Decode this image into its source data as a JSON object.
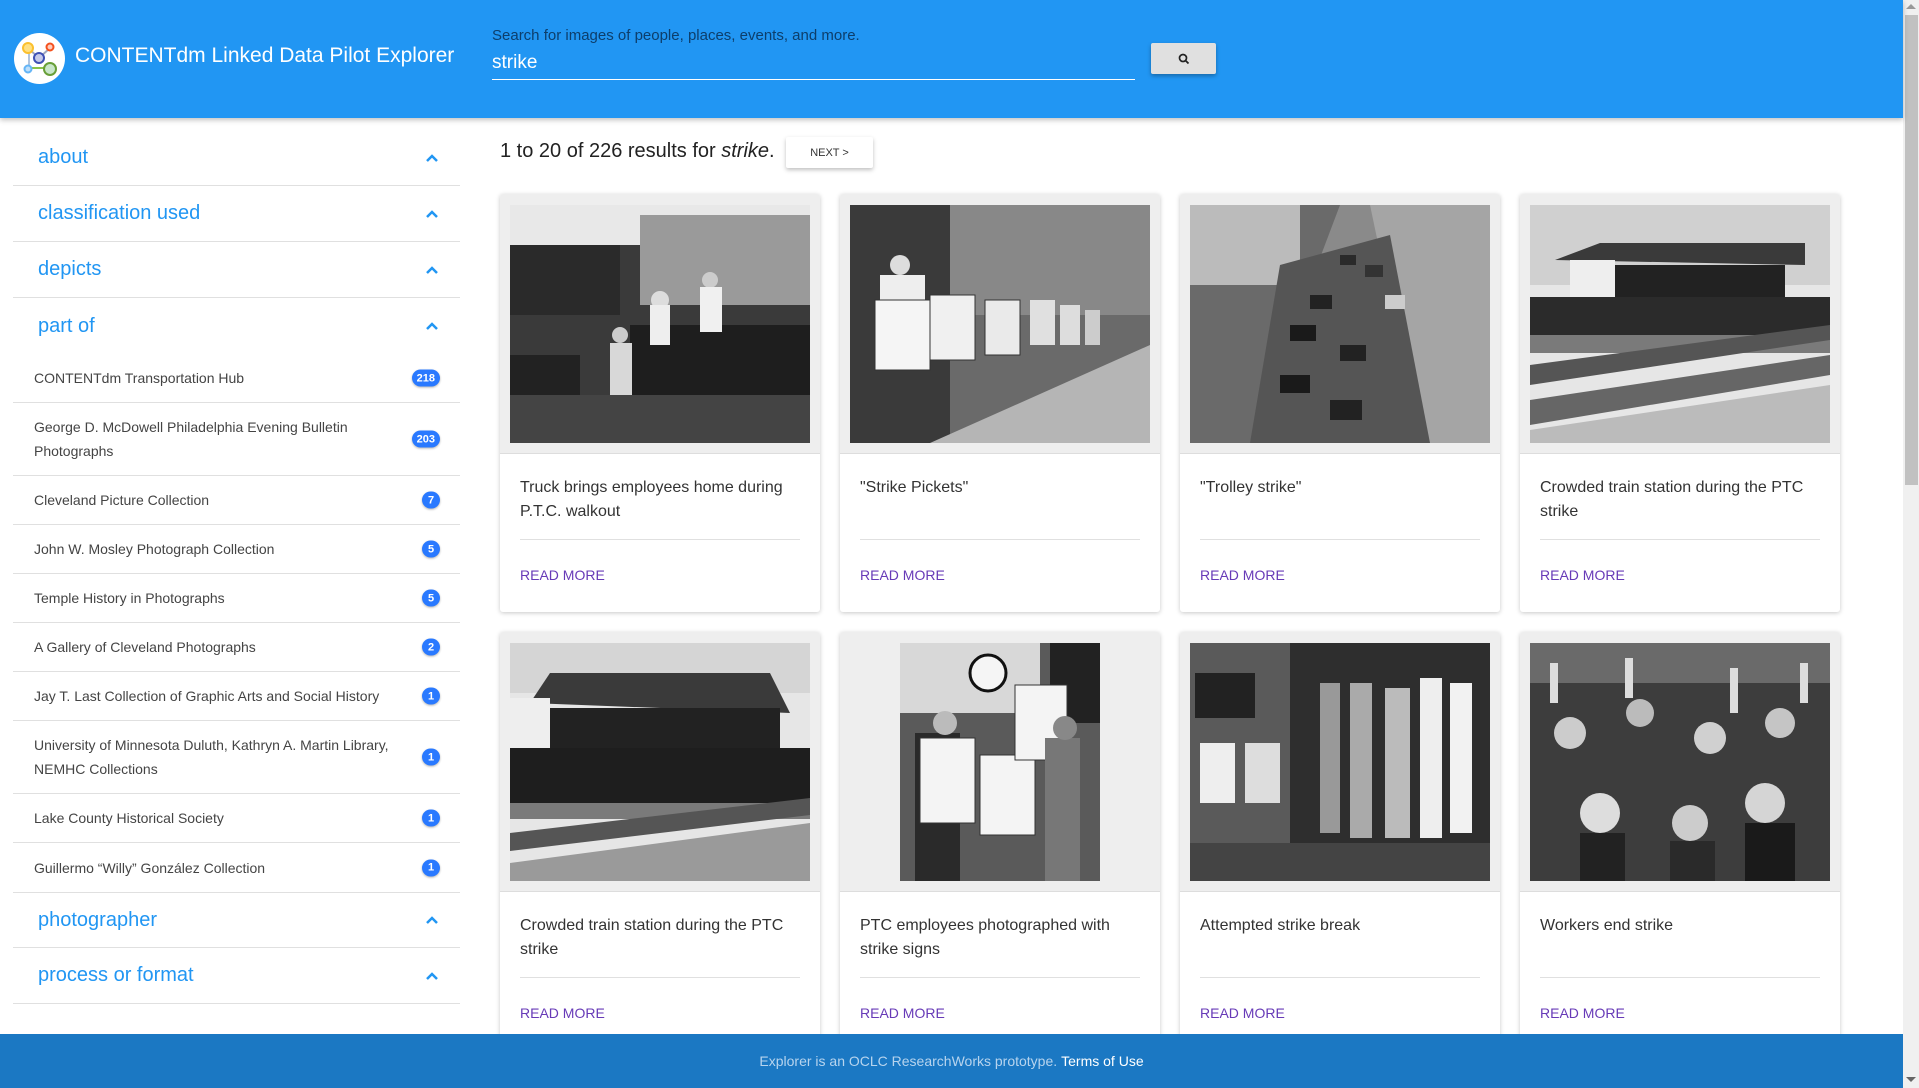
{
  "header": {
    "app_title": "CONTENTdm Linked Data Pilot Explorer",
    "logo_icon": "linked-data-logo",
    "search_label": "Search for images of people, places, events, and more.",
    "search_value": "strike",
    "search_button_icon": "search-icon"
  },
  "sidebar": {
    "sections_before": [
      {
        "label": "about",
        "icon": "chevron-up-icon"
      },
      {
        "label": "classification used",
        "icon": "chevron-up-icon"
      },
      {
        "label": "depicts",
        "icon": "chevron-up-icon"
      }
    ],
    "open_section": {
      "label": "part of",
      "icon": "chevron-up-icon",
      "facets": [
        {
          "label": "CONTENTdm Transportation Hub",
          "count": "218"
        },
        {
          "label": "George D. McDowell Philadelphia Evening Bulletin Photographs",
          "count": "203"
        },
        {
          "label": "Cleveland Picture Collection",
          "count": "7"
        },
        {
          "label": "John W. Mosley Photograph Collection",
          "count": "5"
        },
        {
          "label": "Temple History in Photographs",
          "count": "5"
        },
        {
          "label": "A Gallery of Cleveland Photographs",
          "count": "2"
        },
        {
          "label": "Jay T. Last Collection of Graphic Arts and Social History",
          "count": "1"
        },
        {
          "label": "University of Minnesota Duluth, Kathryn A. Martin Library, NEMHC Collections",
          "count": "1"
        },
        {
          "label": "Lake County Historical Society",
          "count": "1"
        },
        {
          "label": "Guillermo “Willy” González Collection",
          "count": "1"
        }
      ]
    },
    "sections_after": [
      {
        "label": "photographer",
        "icon": "chevron-up-icon"
      },
      {
        "label": "process or format",
        "icon": "chevron-up-icon"
      }
    ]
  },
  "results": {
    "summary_prefix": "1 to 20 of 226 results for ",
    "query": "strike",
    "summary_suffix": ".",
    "next_label": "NEXT >"
  },
  "cards": [
    {
      "title": "Truck brings employees home during P.T.C. walkout",
      "action": "READ MORE",
      "image": "truck-photo"
    },
    {
      "title": "\"Strike Pickets\"",
      "action": "READ MORE",
      "image": "pickets-photo"
    },
    {
      "title": "\"Trolley strike\"",
      "action": "READ MORE",
      "image": "trolley-photo"
    },
    {
      "title": "Crowded train station during the PTC strike",
      "action": "READ MORE",
      "image": "station-photo"
    },
    {
      "title": "Crowded train station during the PTC strike",
      "action": "READ MORE",
      "image": "station-photo-2"
    },
    {
      "title": "PTC employees photographed with strike signs",
      "action": "READ MORE",
      "image": "signs-photo"
    },
    {
      "title": "Attempted strike break",
      "action": "READ MORE",
      "image": "train-photo"
    },
    {
      "title": "Workers end strike",
      "action": "READ MORE",
      "image": "crowd-photo"
    }
  ],
  "footer": {
    "text": "Explorer is an OCLC ResearchWorks prototype.",
    "link": "Terms of Use"
  },
  "colors": {
    "header_bg": "#2196f3",
    "accent": "#2196f3",
    "badge": "#2979ff",
    "link": "#673ab7",
    "footer_bg": "#1b78c3"
  }
}
